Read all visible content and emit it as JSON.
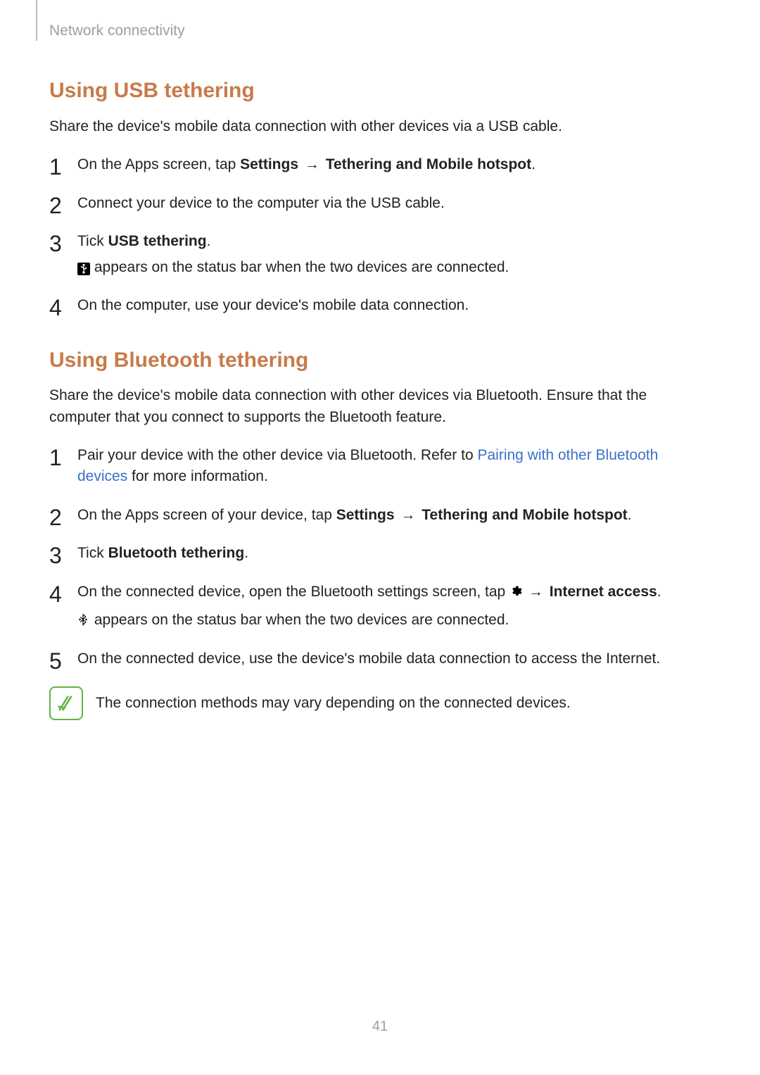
{
  "breadcrumb": "Network connectivity",
  "page_number": "41",
  "arrow_glyph": "→",
  "usb": {
    "heading": "Using USB tethering",
    "intro": "Share the device's mobile data connection with other devices via a USB cable.",
    "step1_a": "On the Apps screen, tap ",
    "step1_settings": "Settings",
    "step1_b": "Tethering and Mobile hotspot",
    "step1_c": ".",
    "step2": "Connect your device to the computer via the USB cable.",
    "step3_a": "Tick ",
    "step3_b": "USB tethering",
    "step3_c": ".",
    "step3_sub": " appears on the status bar when the two devices are connected.",
    "step4": "On the computer, use your device's mobile data connection."
  },
  "bt": {
    "heading": "Using Bluetooth tethering",
    "intro": "Share the device's mobile data connection with other devices via Bluetooth. Ensure that the computer that you connect to supports the Bluetooth feature.",
    "step1_a": "Pair your device with the other device via Bluetooth. Refer to ",
    "step1_link": "Pairing with other Bluetooth devices",
    "step1_b": " for more information.",
    "step2_a": "On the Apps screen of your device, tap ",
    "step2_settings": "Settings",
    "step2_b": "Tethering and Mobile hotspot",
    "step2_c": ".",
    "step3_a": "Tick ",
    "step3_b": "Bluetooth tethering",
    "step3_c": ".",
    "step4_a": "On the connected device, open the Bluetooth settings screen, tap ",
    "step4_b": "Internet access",
    "step4_c": ".",
    "step4_sub": " appears on the status bar when the two devices are connected.",
    "step5": "On the connected device, use the device's mobile data connection to access the Internet.",
    "note": "The connection methods may vary depending on the connected devices."
  }
}
